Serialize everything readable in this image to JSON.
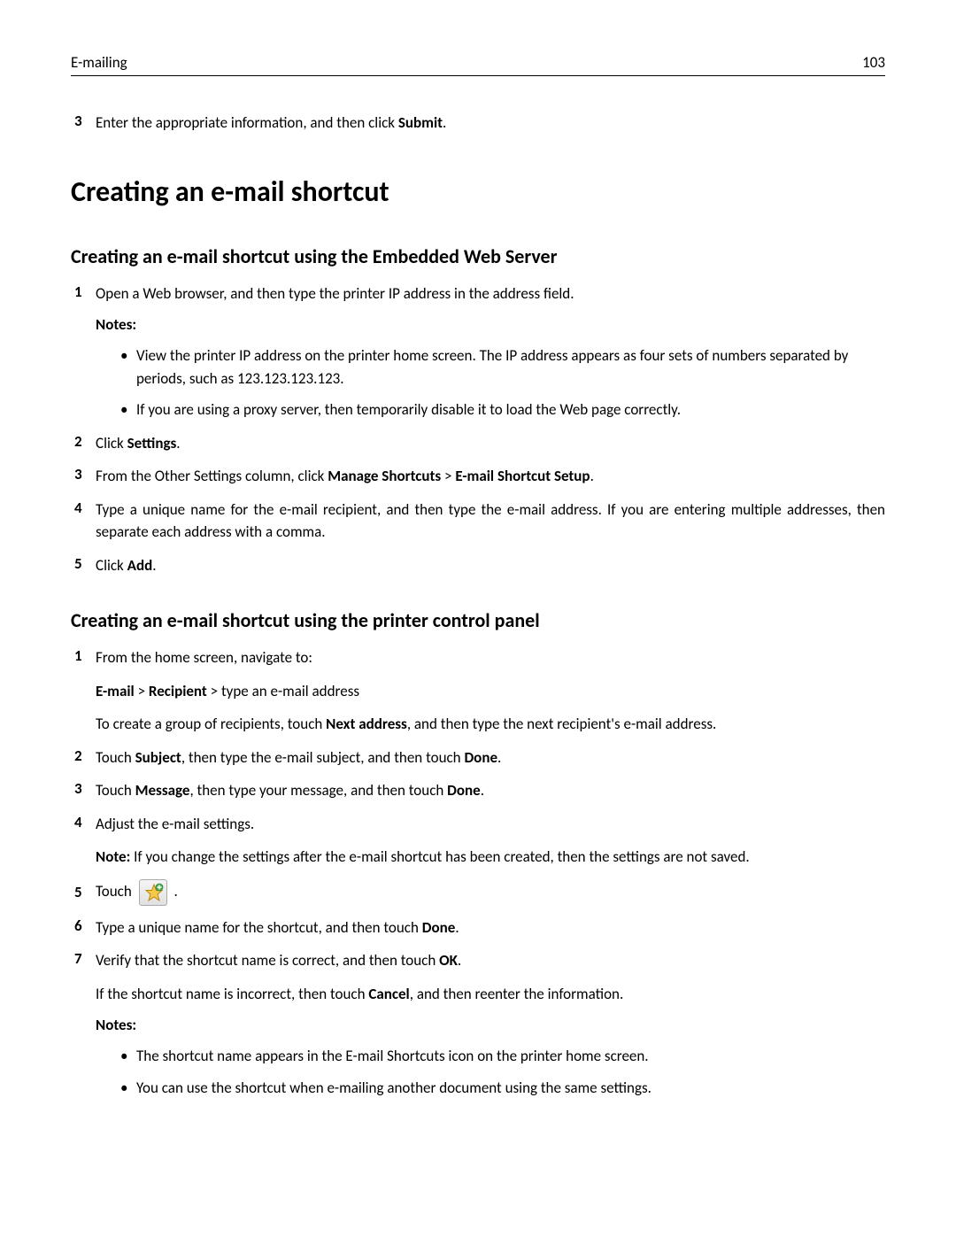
{
  "header": {
    "section_title": "E-mailing",
    "page_number": "103"
  },
  "topstep": {
    "num": "3",
    "text_pre": "Enter the appropriate information, and then click ",
    "text_bold": "Submit",
    "text_post": "."
  },
  "h1": "Creating an e-mail shortcut",
  "section1": {
    "h2": "Creating an e-mail shortcut using the Embedded Web Server",
    "step1": {
      "num": "1",
      "text": "Open a Web browser, and then type the printer IP address in the address field."
    },
    "notes_label": "Notes:",
    "bullet1": "View the printer IP address on the printer home screen. The IP address appears as four sets of numbers separated by periods, such as 123.123.123.123.",
    "bullet2": "If you are using a proxy server, then temporarily disable it to load the Web page correctly.",
    "step2": {
      "num": "2",
      "pre": "Click ",
      "bold": "Settings",
      "post": "."
    },
    "step3": {
      "num": "3",
      "pre": "From the Other Settings column, click ",
      "bold1": "Manage Shortcuts",
      "sep": " > ",
      "bold2": "E-mail Shortcut Setup",
      "post": "."
    },
    "step4": {
      "num": "4",
      "text": "Type a unique name for the e-mail recipient, and then type the e-mail address. If you are entering multiple addresses, then separate each address with a comma."
    },
    "step5": {
      "num": "5",
      "pre": "Click ",
      "bold": "Add",
      "post": "."
    }
  },
  "section2": {
    "h2": "Creating an e-mail shortcut using the printer control panel",
    "step1": {
      "num": "1",
      "text": "From the home screen, navigate to:",
      "line2_bold1": "E-mail",
      "line2_sep1": " > ",
      "line2_bold2": "Recipient",
      "line2_rest": " > type an e-mail address",
      "line3_pre": "To create a group of recipients, touch ",
      "line3_bold": "Next address",
      "line3_post": ", and then type the next recipient's e-mail address."
    },
    "step2": {
      "num": "2",
      "pre": "Touch ",
      "bold1": "Subject",
      "mid": ", then type the e-mail subject, and then touch ",
      "bold2": "Done",
      "post": "."
    },
    "step3": {
      "num": "3",
      "pre": "Touch ",
      "bold1": "Message",
      "mid": ", then type your message, and then touch ",
      "bold2": "Done",
      "post": "."
    },
    "step4": {
      "num": "4",
      "text": "Adjust the e-mail settings.",
      "note_label": "Note:",
      "note_text": " If you change the settings after the e-mail shortcut has been created, then the settings are not saved."
    },
    "step5": {
      "num": "5",
      "pre": "Touch ",
      "post": " ."
    },
    "step6": {
      "num": "6",
      "pre": "Type a unique name for the shortcut, and then touch ",
      "bold": "Done",
      "post": "."
    },
    "step7": {
      "num": "7",
      "pre": "Verify that the shortcut name is correct, and then touch ",
      "bold": "OK",
      "post": ".",
      "line2_pre": "If the shortcut name is incorrect, then touch ",
      "line2_bold": "Cancel",
      "line2_post": ", and then reenter the information."
    },
    "notes_label": "Notes:",
    "bullet1": "The shortcut name appears in the E-mail Shortcuts icon on the printer home screen.",
    "bullet2": "You can use the shortcut when e-mailing another document using the same settings."
  }
}
